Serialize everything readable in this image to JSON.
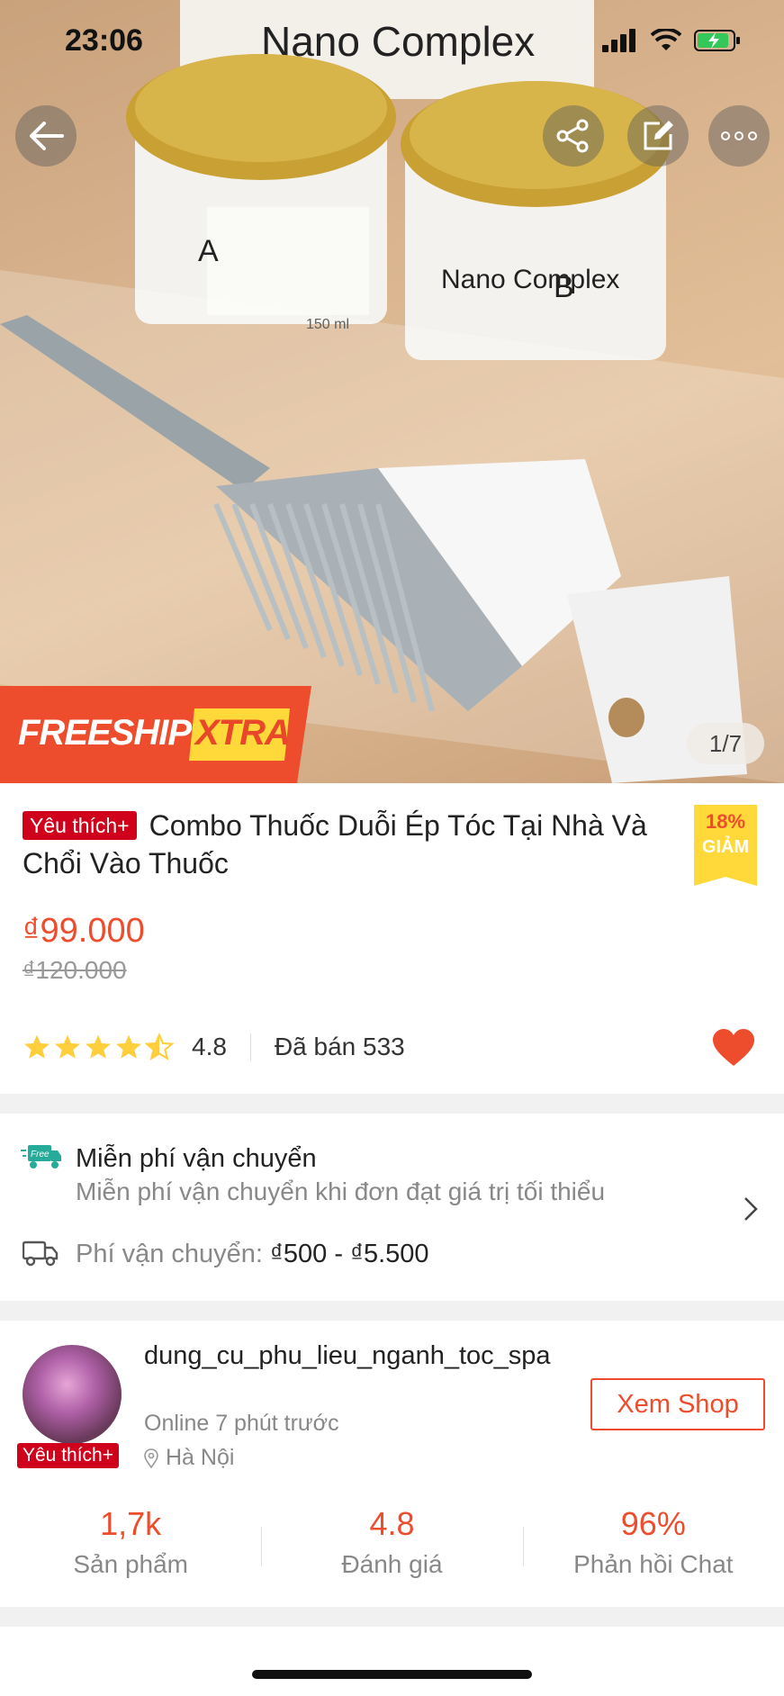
{
  "status_bar": {
    "time": "23:06"
  },
  "image_counter": "1/7",
  "freeship": {
    "label": "FREESHIP",
    "extra": "XTRA"
  },
  "product": {
    "badge": "Yêu thích+",
    "title": "Combo Thuốc Duỗi Ép Tóc Tại Nhà Và Chổi Vào Thuốc",
    "discount_pct": "18%",
    "discount_label": "GIẢM",
    "price": "₫99.000",
    "old_price": "₫120.000",
    "rating": "4.8",
    "rating_value": 4.5,
    "sold": "Đã bán 533",
    "liked": true
  },
  "product_photo": {
    "jar_text": [
      "Nano Complex",
      "A",
      "B",
      "150 ml"
    ]
  },
  "shipping": {
    "free_icon_text": "Free",
    "title": "Miễn phí vận chuyển",
    "subtitle": "Miễn phí vận chuyển khi đơn đạt giá trị tối thiểu",
    "fee_label": "Phí vận chuyển: ",
    "fee_value": "₫500 - ₫5.500"
  },
  "shop": {
    "badge": "Yêu thích+",
    "name": "dung_cu_phu_lieu_nganh_toc_spa",
    "online": "Online 7 phút trước",
    "location": "Hà Nội",
    "view_button": "Xem Shop",
    "stats": [
      {
        "value": "1,7k",
        "label": "Sản phẩm"
      },
      {
        "value": "4.8",
        "label": "Đánh giá"
      },
      {
        "value": "96%",
        "label": "Phản hồi Chat"
      }
    ]
  },
  "colors": {
    "accent": "#ee4d2d",
    "badge_red": "#d0011b",
    "star": "#ffce3d",
    "discount_bg": "#ffd839"
  }
}
